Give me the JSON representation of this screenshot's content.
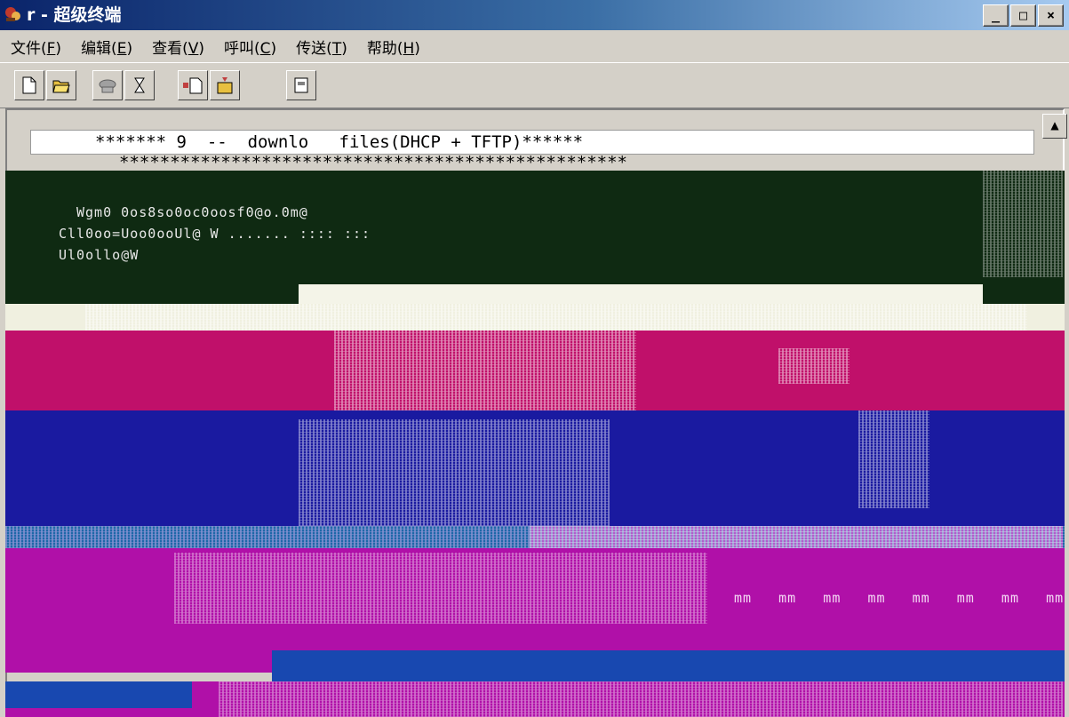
{
  "window": {
    "title": "r - 超级终端",
    "controls": {
      "minimize": "_",
      "maximize": "□",
      "close": "×"
    }
  },
  "menu": {
    "items": [
      {
        "label": "文件(",
        "key": "F",
        "suffix": ")"
      },
      {
        "label": "编辑(",
        "key": "E",
        "suffix": ")"
      },
      {
        "label": "查看(",
        "key": "V",
        "suffix": ")"
      },
      {
        "label": "呼叫(",
        "key": "C",
        "suffix": ")"
      },
      {
        "label": "传送(",
        "key": "T",
        "suffix": ")"
      },
      {
        "label": "帮助(",
        "key": "H",
        "suffix": ")"
      }
    ]
  },
  "toolbar": {
    "buttons": [
      "new-document-icon",
      "open-folder-icon",
      "phone-connect-icon",
      "disconnect-icon",
      "send-file-icon",
      "receive-file-icon",
      "properties-icon"
    ]
  },
  "terminal": {
    "line1": "******* 9  --  downlo   files(DHCP + TFTP)******",
    "line2": "**************************************************",
    "garbled_line_a": "Wgm0 0os8so0oc0oosf0@o.0m@",
    "garbled_line_b": "Cll0oo=Uoo0ooUl@ W ....... :::: :::",
    "garbled_line_c": "Ul0ollo@W",
    "repeat_text": "mm   mm   mm   mm   mm   mm   mm   mm"
  },
  "colors": {
    "title_gradient_start": "#0a246a",
    "title_gradient_end": "#a6caf0",
    "chrome": "#d4d0c8",
    "corrupt_dark_green": "#0f2a12",
    "corrupt_magenta": "#c0106a",
    "corrupt_blue": "#1a1aa0",
    "corrupt_purple": "#b010a8"
  }
}
